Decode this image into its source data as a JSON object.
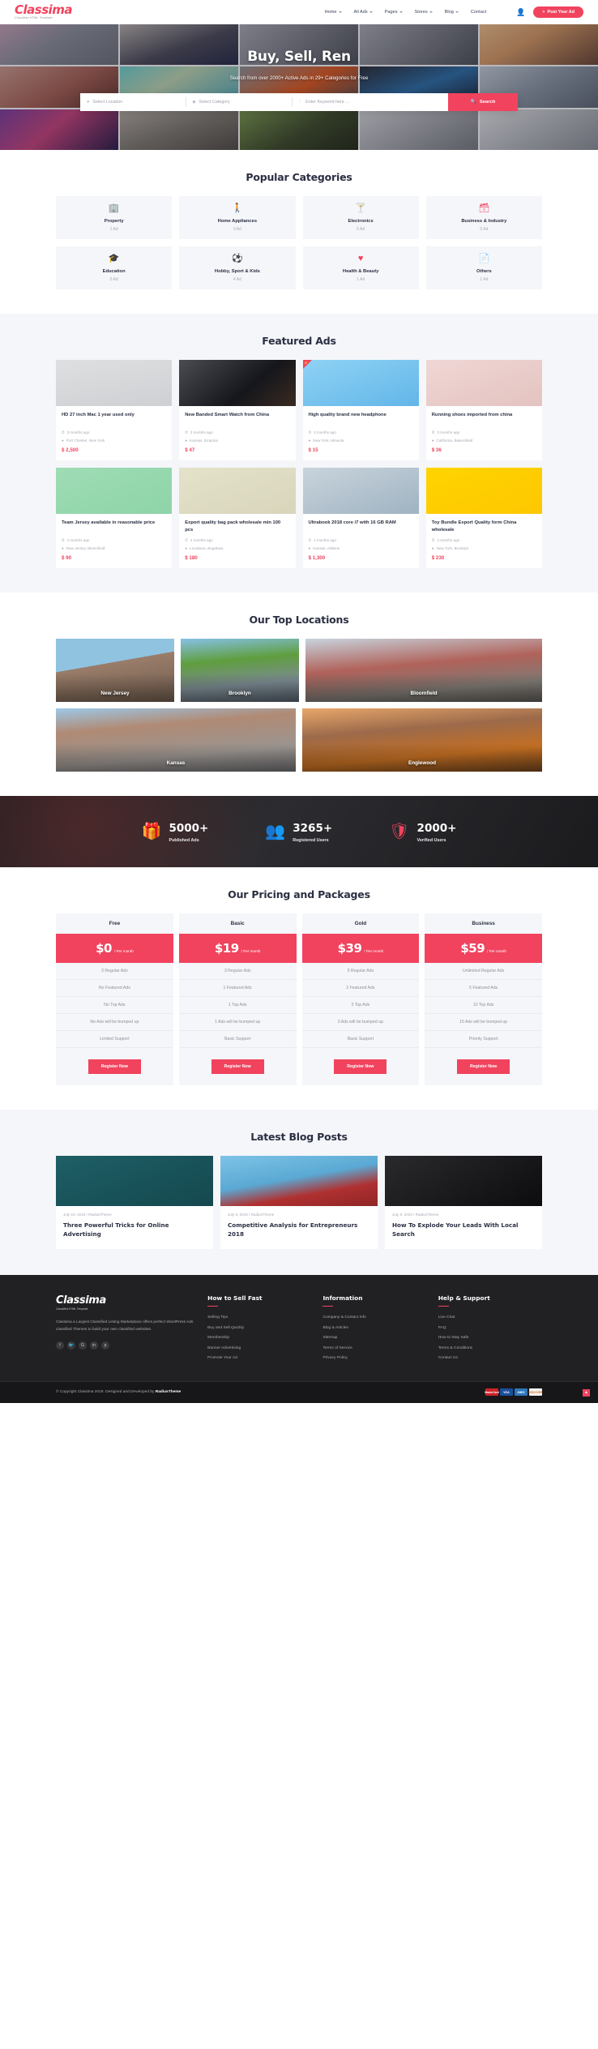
{
  "header": {
    "logo": {
      "main": "Classima",
      "sub": "Classified HTML Template"
    },
    "nav": [
      {
        "label": "Home",
        "caret": true
      },
      {
        "label": "All Ads",
        "caret": true
      },
      {
        "label": "Pages",
        "caret": true
      },
      {
        "label": "Stores",
        "caret": true
      },
      {
        "label": "Blog",
        "caret": true
      },
      {
        "label": "Contact",
        "caret": false
      }
    ],
    "user_icon": "user-icon",
    "post_ad_label": "Post Your Ad",
    "post_ad_icon": "plus-icon"
  },
  "hero": {
    "title": "Buy, Sell, Ren",
    "subtitle": "Search from over 2000+ Active Ads in 29+ Categories for Free",
    "search": {
      "location_placeholder": "Select Location",
      "location_icon": "map-pin-icon",
      "category_placeholder": "Select Category",
      "category_icon": "tag-icon",
      "keyword_placeholder": "Enter Keyword here ...",
      "keyword_icon": "filter-icon",
      "button_label": "Search",
      "button_icon": "search-icon"
    }
  },
  "categories": {
    "title": "Popular Categories",
    "items": [
      {
        "icon": "building-icon",
        "glyph": "🏢",
        "name": "Property",
        "count": "1 Ad"
      },
      {
        "icon": "person-icon",
        "glyph": "🚶",
        "name": "Home Appliances",
        "count": "3 Ad"
      },
      {
        "icon": "cocktail-icon",
        "glyph": "🍸",
        "name": "Electronics",
        "count": "6 Ad"
      },
      {
        "icon": "box-icon",
        "glyph": "🗃",
        "name": "Business & Industry",
        "count": "0 Ad"
      },
      {
        "icon": "graduation-cap-icon",
        "glyph": "🎓",
        "name": "Education",
        "count": "0 Ad"
      },
      {
        "icon": "soccer-ball-icon",
        "glyph": "⚽",
        "name": "Hobby, Sport & Kids",
        "count": "4 Ad"
      },
      {
        "icon": "heart-icon",
        "glyph": "♥",
        "name": "Health & Beauty",
        "count": "1 Ad"
      },
      {
        "icon": "document-icon",
        "glyph": "📄",
        "name": "Others",
        "count": "1 Ad"
      }
    ]
  },
  "featured": {
    "title": "Featured Ads",
    "time_icon": "clock-icon",
    "place_icon": "map-pin-icon",
    "ads": [
      {
        "thumb": "th-mac",
        "featured": false,
        "title": "HD 27 inch Mac 1 year used only",
        "time": "3 months ago",
        "place": "Port Chester, New York",
        "price": "$ 2,500"
      },
      {
        "thumb": "th-watch",
        "featured": false,
        "title": "New Banded Smart Watch from China",
        "time": "3 months ago",
        "place": "Kansas, Emporia",
        "price": "$ 47"
      },
      {
        "thumb": "th-hp",
        "featured": true,
        "title": "High quality brand new headphone",
        "time": "3 months ago",
        "place": "New York, Mineola",
        "price": "$ 15"
      },
      {
        "thumb": "th-shoe",
        "featured": false,
        "title": "Running shoes imported from china",
        "time": "3 months ago",
        "place": "California, Bakersfield",
        "price": "$ 36"
      },
      {
        "thumb": "th-jersey",
        "featured": false,
        "title": "Team Jersey available in reasonable price",
        "time": "4 months ago",
        "place": "New Jersey, Bloomfield",
        "price": "$ 90"
      },
      {
        "thumb": "th-bag",
        "featured": false,
        "title": "Export quality bag pack wholesale min 100 pcs",
        "time": "4 months ago",
        "place": "Louisiana, Bogalusa",
        "price": "$ 180"
      },
      {
        "thumb": "th-laptop",
        "featured": false,
        "title": "Ultrabook 2018 core i7 with 16 GB RAM",
        "time": "4 months ago",
        "place": "Kansas, Abilene",
        "price": "$ 1,300"
      },
      {
        "thumb": "th-toy",
        "featured": false,
        "title": "Toy Bundle Export Quality form China wholesale",
        "time": "4 months ago",
        "place": "New York, Brooklyn",
        "price": "$ 230"
      }
    ]
  },
  "locations": {
    "title": "Our Top Locations",
    "row1": [
      {
        "name": "New Jersey",
        "bg": "l1"
      },
      {
        "name": "Brooklyn",
        "bg": "l2"
      },
      {
        "name": "Bloomfield",
        "bg": "l3"
      }
    ],
    "row2": [
      {
        "name": "Kansas",
        "bg": "l4"
      },
      {
        "name": "Englewood",
        "bg": "l5"
      }
    ]
  },
  "counters": [
    {
      "icon": "gift-icon",
      "glyph": "🎁",
      "number": "5000+",
      "label": "Published Ads"
    },
    {
      "icon": "users-icon",
      "glyph": "👥",
      "number": "3265+",
      "label": "Registered Users"
    },
    {
      "icon": "shield-check-icon",
      "glyph": "🛡",
      "number": "2000+",
      "label": "Verified Users"
    }
  ],
  "pricing": {
    "title": "Our Pricing and Packages",
    "per": "/ Per month",
    "button_label": "Register Now",
    "plans": [
      {
        "name": "Free",
        "price": "$0",
        "features": [
          "3 Regular Ads",
          "No Featured Ads",
          "No Top Ads",
          "No Ads will be bumped up",
          "Limited Support"
        ]
      },
      {
        "name": "Basic",
        "price": "$19",
        "features": [
          "3 Regular Ads",
          "1 Featured Ads",
          "1 Top Ads",
          "1 Ads will be bumped up",
          "Basic Support"
        ]
      },
      {
        "name": "Gold",
        "price": "$39",
        "features": [
          "5 Regular Ads",
          "2 Featured Ads",
          "3 Top Ads",
          "3 Ads will be bumped up",
          "Basic Support"
        ]
      },
      {
        "name": "Business",
        "price": "$59",
        "features": [
          "Unlimited Regular Ads",
          "5 Featured Ads",
          "10 Top Ads",
          "15 Ads will be bumped up",
          "Priority Support"
        ]
      }
    ]
  },
  "blog": {
    "title": "Latest Blog Posts",
    "posts": [
      {
        "thumb": "b1",
        "meta": "July 10, 2019 / RadiusTheme",
        "title": "Three Powerful Tricks for Online Advertising"
      },
      {
        "thumb": "b2",
        "meta": "July 9, 2019 / RadiusTheme",
        "title": "Competitive Analysis for Entrepreneurs 2018"
      },
      {
        "thumb": "b3",
        "meta": "July 8, 2019 / RadiusTheme",
        "title": "How To Explode Your Leads With Local Search"
      }
    ]
  },
  "footer": {
    "logo": {
      "main": "Classima",
      "sub": "Classified HTML Template"
    },
    "description": "Classima a Largest Classified Listing Marketplace offers perfect WordPress Ads classified Themes to build your own classified websites.",
    "social": [
      {
        "icon": "facebook-icon",
        "glyph": "f"
      },
      {
        "icon": "twitter-icon",
        "glyph": "🐦"
      },
      {
        "icon": "google-plus-icon",
        "glyph": "G"
      },
      {
        "icon": "linkedin-icon",
        "glyph": "in"
      },
      {
        "icon": "pinterest-icon",
        "glyph": "p"
      }
    ],
    "columns": [
      {
        "heading": "How to Sell Fast",
        "links": [
          "Selling Tips",
          "Buy and Sell Quickly",
          "Membership",
          "Banner Advertising",
          "Promote Your Ad"
        ]
      },
      {
        "heading": "Information",
        "links": [
          "Company & Contact Info",
          "Blog & Articles",
          "Sitemap",
          "Terms of Service",
          "Privacy Policy"
        ]
      },
      {
        "heading": "Help & Support",
        "links": [
          "Live Chat",
          "FAQ",
          "How to Stay Safe",
          "Terms & Conditions",
          "Contact Us"
        ]
      }
    ],
    "copyright_prefix": "© Copyright Classima 2019. Designed and Developed by ",
    "copyright_brand": "RadiusTheme",
    "payment_cards": [
      {
        "name": "mastercard-card",
        "label": "MasterCard",
        "cls": "c-mc"
      },
      {
        "name": "visa-card",
        "label": "VISA",
        "cls": "c-visa"
      },
      {
        "name": "amex-card",
        "label": "AMEX",
        "cls": "c-amex"
      },
      {
        "name": "discover-card",
        "label": "DISCOVER",
        "cls": "c-disc"
      }
    ],
    "back_to_top_icon": "chevron-up-icon"
  },
  "colors": {
    "accent": "#f1435e",
    "dark": "#212124",
    "grey_bg": "#f5f6fa",
    "text": "#2b2f42"
  }
}
